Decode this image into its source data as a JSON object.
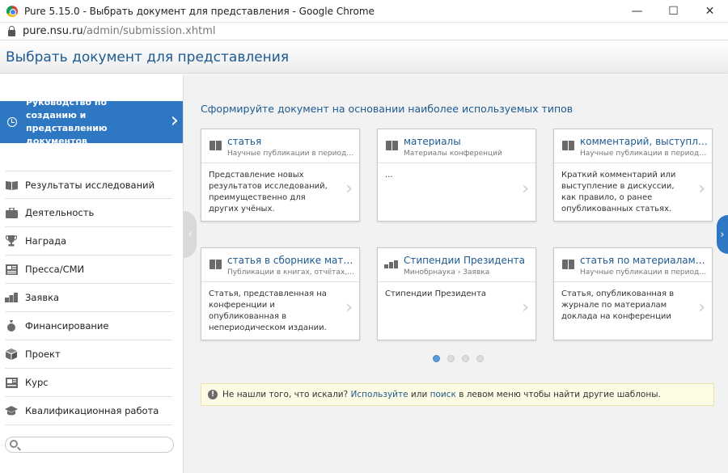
{
  "window": {
    "title": "Pure 5.15.0 - Выбрать документ для представления - Google Chrome",
    "minimize": "—",
    "maximize": "☐",
    "close": "✕"
  },
  "address": {
    "host": "pure.nsu.ru",
    "path": "/admin/submission.xhtml"
  },
  "page": {
    "title": "Выбрать документ для представления"
  },
  "sidebar": {
    "guide_label": "Руководство по созданию и представлению документов",
    "items": [
      {
        "label": "Результаты исследований",
        "icon": "book-icon"
      },
      {
        "label": "Деятельность",
        "icon": "briefcase-icon"
      },
      {
        "label": "Награда",
        "icon": "trophy-icon"
      },
      {
        "label": "Пресса/СМИ",
        "icon": "newspaper-icon"
      },
      {
        "label": "Заявка",
        "icon": "money-icon"
      },
      {
        "label": "Финансирование",
        "icon": "moneybag-icon"
      },
      {
        "label": "Проект",
        "icon": "box-icon"
      },
      {
        "label": "Курс",
        "icon": "presentation-icon"
      },
      {
        "label": "Квалификационная работа",
        "icon": "graduation-cap-icon"
      }
    ],
    "search_placeholder": ""
  },
  "main": {
    "heading": "Сформируйте документ на основании наиболее используемых типов",
    "cards": [
      {
        "title": "статья",
        "subtitle": "Научные публикации в периодических изданиях",
        "description": "Представление новых результатов исследований, преимущественно для других учёных.",
        "icon": "book-icon"
      },
      {
        "title": "материалы",
        "subtitle": "Материалы конференций",
        "description": "...",
        "icon": "book-icon"
      },
      {
        "title": "комментарий, выступление в дискуссии",
        "subtitle": "Научные публикации в периодических изданиях",
        "description": "Краткий комментарий или выступление в дискуссии, как правило, о ранее опубликованных статьях.",
        "icon": "book-icon"
      },
      {
        "title": "статья в сборнике материалов конференции",
        "subtitle": "Публикации в книгах, отчётах, сборниках",
        "description": "Статья, представленная на конференции и опубликованная в непериодическом издании.",
        "icon": "book-icon"
      },
      {
        "title": "Стипендии Президента",
        "subtitle": "Минобрнаука › Заявка",
        "description": "Стипендии Президента",
        "icon": "money-icon"
      },
      {
        "title": "статья по материалам конференции",
        "subtitle": "Научные публикации в периодических изданиях",
        "description": "Статья, опубликованная в журнале по материалам доклада на конференции",
        "icon": "book-icon"
      }
    ],
    "pager": {
      "count": 4,
      "active": 1
    },
    "notice": {
      "text_before": "Не нашли того, что искали?",
      "link1": "Используйте",
      "text_middle": "или",
      "link2": "поиск",
      "text_after": "в левом меню чтобы найти другие шаблоны."
    }
  }
}
